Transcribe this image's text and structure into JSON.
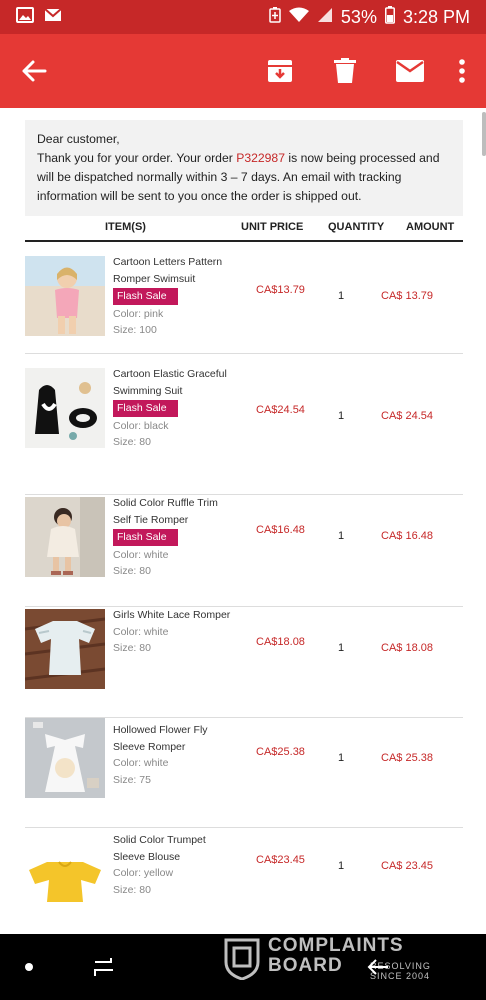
{
  "status_bar": {
    "battery": "53%",
    "time": "3:28 PM",
    "icons": [
      "image-icon",
      "gmail-icon",
      "battery-saver-icon",
      "wifi-icon",
      "signal-icon",
      "battery-icon"
    ]
  },
  "app_bar": {
    "icons": [
      "back-arrow-icon",
      "archive-icon",
      "delete-icon",
      "mail-icon",
      "more-vert-icon"
    ]
  },
  "notice": {
    "greeting": "Dear customer,",
    "text_before": "Thank you for your order. Your order ",
    "order_number": "P322987",
    "text_after": " is now being processed and will be dispatched normally within 3 – 7 days. An email with tracking information will be sent to you once the order is shipped out."
  },
  "table": {
    "headers": {
      "item": "ITEM(S)",
      "unit_price": "UNIT PRICE",
      "quantity": "QUANTITY",
      "amount": "AMOUNT"
    },
    "rows": [
      {
        "name": "Cartoon Letters Pattern Romper Swimsuit",
        "badge": "Flash Sale",
        "color": "Color: pink",
        "size": "Size: 100",
        "unit_price": "CA$13.79",
        "quantity": "1",
        "amount": "CA$ 13.79"
      },
      {
        "name": "Cartoon Elastic Graceful Swimming Suit",
        "badge": "Flash Sale",
        "color": "Color: black",
        "size": "Size: 80",
        "unit_price": "CA$24.54",
        "quantity": "1",
        "amount": "CA$ 24.54"
      },
      {
        "name": "Solid Color Ruffle Trim Self Tie Romper",
        "badge": "Flash Sale",
        "color": "Color: white",
        "size": "Size: 80",
        "unit_price": "CA$16.48",
        "quantity": "1",
        "amount": "CA$ 16.48"
      },
      {
        "name": "Girls White Lace Romper",
        "badge": "",
        "color": "Color: white",
        "size": "Size: 80",
        "unit_price": "CA$18.08",
        "quantity": "1",
        "amount": "CA$ 18.08"
      },
      {
        "name": "Hollowed Flower Fly Sleeve Romper",
        "badge": "",
        "color": "Color: white",
        "size": "Size: 75",
        "unit_price": "CA$25.38",
        "quantity": "1",
        "amount": "CA$ 25.38"
      },
      {
        "name": "Solid Color Trumpet Sleeve Blouse",
        "badge": "",
        "color": "Color: yellow",
        "size": "Size: 80",
        "unit_price": "CA$23.45",
        "quantity": "1",
        "amount": "CA$ 23.45"
      }
    ]
  },
  "watermark": {
    "line1": "COMPLAINTS",
    "line2": "BOARD",
    "tagline": "RESOLVING SINCE 2004"
  },
  "colors": {
    "status_bar": "#c62828",
    "app_bar": "#e53935",
    "accent_red": "#c62828",
    "badge": "#c2185b"
  }
}
